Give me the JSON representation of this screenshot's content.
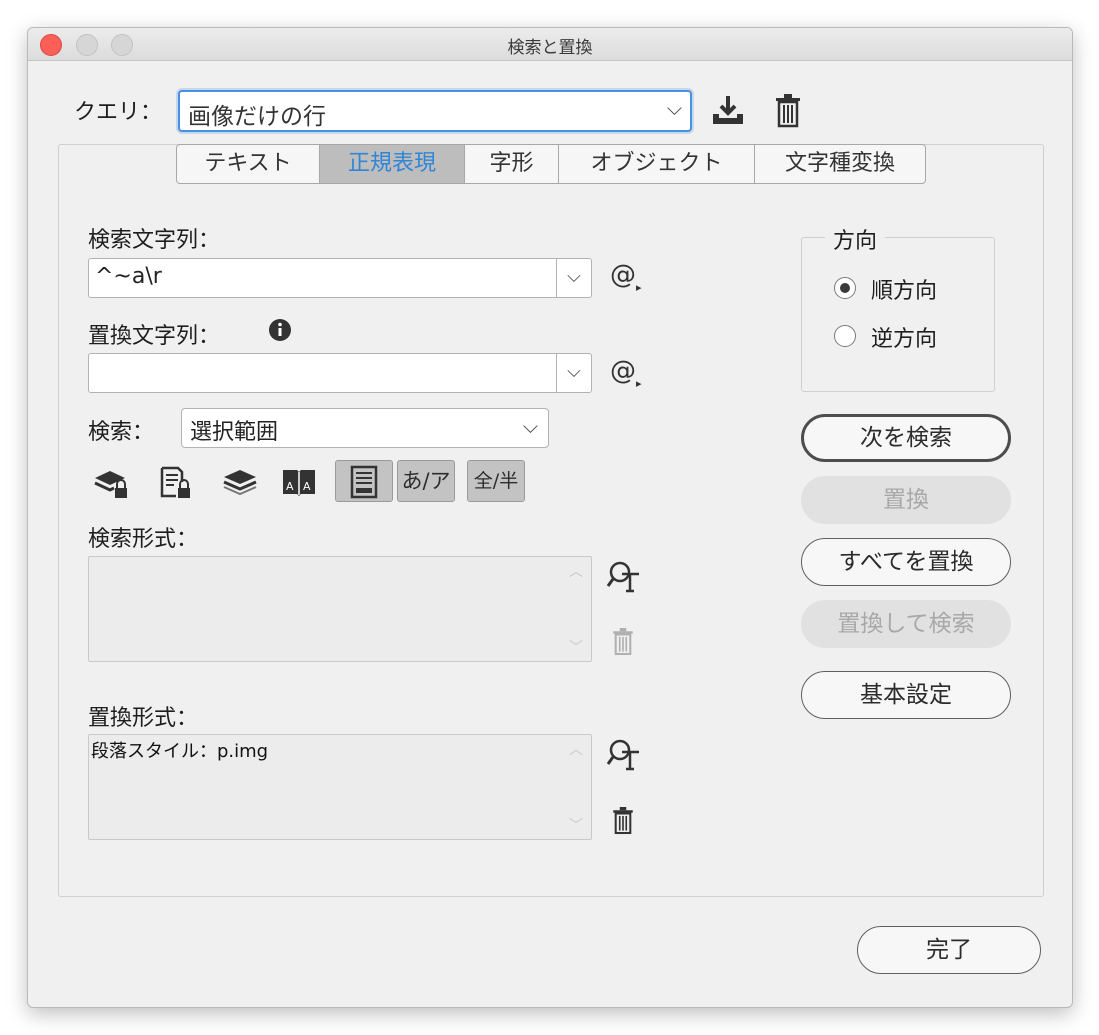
{
  "window": {
    "title": "検索と置換"
  },
  "query": {
    "label": "クエリ：",
    "value": "画像だけの行"
  },
  "tabs": [
    "テキスト",
    "正規表現",
    "字形",
    "オブジェクト",
    "文字種変換"
  ],
  "find": {
    "label": "検索文字列：",
    "value": "^~a\\r"
  },
  "replace": {
    "label": "置換文字列：",
    "value": ""
  },
  "search_scope": {
    "label": "検索：",
    "value": "選択範囲"
  },
  "option_toggles": {
    "kana": "あ/ア",
    "width": "全/半"
  },
  "find_format": {
    "label": "検索形式：",
    "value": ""
  },
  "replace_format": {
    "label": "置換形式：",
    "value": "段落スタイル：p.img"
  },
  "direction": {
    "title": "方向",
    "forward": "順方向",
    "backward": "逆方向"
  },
  "buttons": {
    "find_next": "次を検索",
    "replace": "置換",
    "replace_all": "すべてを置換",
    "replace_find": "置換して検索",
    "more_options": "基本設定",
    "done": "完了"
  },
  "colors": {
    "focus": "#4a90e2",
    "tab_active_text": "#2f86d6",
    "close": "#fc5f57"
  }
}
